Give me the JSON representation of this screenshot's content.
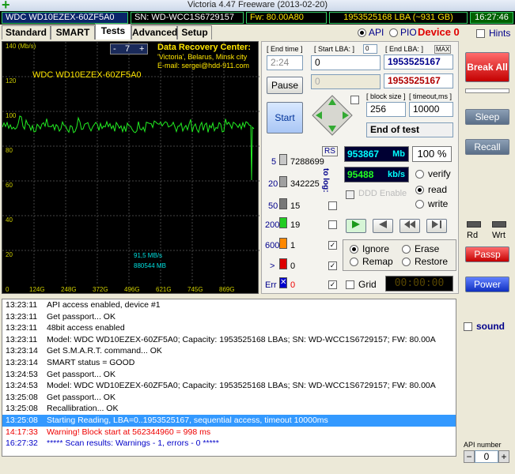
{
  "window": {
    "title": "Victoria 4.47  Freeware (2013-02-20)",
    "icon": "plus-app-icon"
  },
  "info_bar": {
    "model": "WDC WD10EZEX-60ZF5A0",
    "serial": "SN: WD-WCC1S6729157",
    "firmware": "Fw: 80.00A80",
    "lba": "1953525168 LBA (~931 GB)",
    "clock": "16:27:46"
  },
  "tabs": [
    {
      "label": "Standard"
    },
    {
      "label": "SMART"
    },
    {
      "label": "Tests"
    },
    {
      "label": "Advanced"
    },
    {
      "label": "Setup"
    }
  ],
  "mode": {
    "api_label": "API",
    "pio_label": "PIO",
    "device_label": "Device 0",
    "hints_label": "Hints"
  },
  "graph": {
    "y_ticks": [
      "140 (Mb/s)",
      "120",
      "100",
      "80",
      "60",
      "40",
      "20"
    ],
    "x_ticks": [
      "0",
      "124G",
      "248G",
      "372G",
      "496G",
      "621G",
      "745G",
      "869G"
    ],
    "counter": "7",
    "minus": "-",
    "plus": "+",
    "drive_label": "WDC WD10EZEX-60ZF5A0",
    "recovery_title": "Data Recovery Center:",
    "recovery_line2": "'Victoria', Belarus, Minsk city",
    "recovery_line3": "E-mail: sergei@hdd-911.com",
    "speed_text": "91,5 MB/s",
    "size_text": "880544 MB"
  },
  "controls": {
    "end_time_label": "[ End time ]",
    "end_time_value": "2:24",
    "start_lba_label": "[ Start LBA: ]",
    "start_lba_small": "0",
    "start_lba_value": "0",
    "end_lba_label": "[ End LBA: ]",
    "end_lba_max": "MAX",
    "end_lba_value": "1953525167",
    "end_lba_value2": "1953525167",
    "pause_label": "Pause",
    "start_label": "Start",
    "block_size_label": "[ block size ]",
    "block_size_value": "256",
    "timeout_label": "[ timeout,ms ]",
    "timeout_value": "10000",
    "end_action_value": "End of test",
    "rs_label": "RS",
    "to_log_label": "to log:",
    "ddd_label": "DDD Enable",
    "grid_label": "Grid",
    "timer_value": "00:00:00",
    "read_mb": "953867",
    "read_mb_unit": "Mb",
    "percent": "100",
    "percent_unit": "%",
    "speed_kbs": "95488",
    "speed_unit": "kb/s",
    "verify_label": "verify",
    "read_label": "read",
    "write_label": "write",
    "ignore_label": "Ignore",
    "erase_label": "Erase",
    "remap_label": "Remap",
    "restore_label": "Restore"
  },
  "counters": [
    {
      "label": "5",
      "value": "7288699",
      "color": "#c8c8c8",
      "log": false
    },
    {
      "label": "20",
      "value": "342225",
      "color": "#a0a0a0",
      "log": false
    },
    {
      "label": "50",
      "value": "15",
      "color": "#787878",
      "log": false
    },
    {
      "label": "200",
      "value": "19",
      "color": "#22cc22",
      "log": false
    },
    {
      "label": "600",
      "value": "1",
      "color": "#ff8800",
      "log": true
    },
    {
      "label": ">",
      "value": "0",
      "color": "#dd0000",
      "log": true
    },
    {
      "label": "Err",
      "value": "0",
      "color": "#0000cc",
      "log": true
    }
  ],
  "side": {
    "break_all": "Break All",
    "sleep": "Sleep",
    "recall": "Recall",
    "rd": "Rd",
    "wrt": "Wrt",
    "passp": "Passp",
    "power": "Power",
    "sound": "sound",
    "api_number_label": "API number",
    "api_number_value": "0"
  },
  "log": [
    {
      "time": "13:23:11",
      "msg": "API access enabled, device #1",
      "kind": "normal"
    },
    {
      "time": "13:23:11",
      "msg": "Get passport... OK",
      "kind": "normal"
    },
    {
      "time": "13:23:11",
      "msg": "48bit access enabled",
      "kind": "normal"
    },
    {
      "time": "13:23:11",
      "msg": "Model: WDC WD10EZEX-60ZF5A0; Capacity: 1953525168 LBAs; SN: WD-WCC1S6729157; FW: 80.00A",
      "kind": "normal"
    },
    {
      "time": "13:23:14",
      "msg": "Get S.M.A.R.T. command... OK",
      "kind": "normal"
    },
    {
      "time": "13:23:14",
      "msg": "SMART status = GOOD",
      "kind": "normal"
    },
    {
      "time": "13:24:53",
      "msg": "Get passport... OK",
      "kind": "normal"
    },
    {
      "time": "13:24:53",
      "msg": "Model: WDC WD10EZEX-60ZF5A0; Capacity: 1953525168 LBAs; SN: WD-WCC1S6729157; FW: 80.00A",
      "kind": "normal"
    },
    {
      "time": "13:25:08",
      "msg": "Get passport... OK",
      "kind": "normal"
    },
    {
      "time": "13:25:08",
      "msg": "Recallibration... OK",
      "kind": "normal"
    },
    {
      "time": "13:25:08",
      "msg": "Starting Reading, LBA=0..1953525167, sequential access, timeout 10000ms",
      "kind": "hl"
    },
    {
      "time": "14:17:33",
      "msg": "Warning! Block start at 562344960 = 998 ms",
      "kind": "warn"
    },
    {
      "time": "16:27:32",
      "msg": "***** Scan results: Warnings - 1, errors - 0 *****",
      "kind": "scan"
    }
  ]
}
